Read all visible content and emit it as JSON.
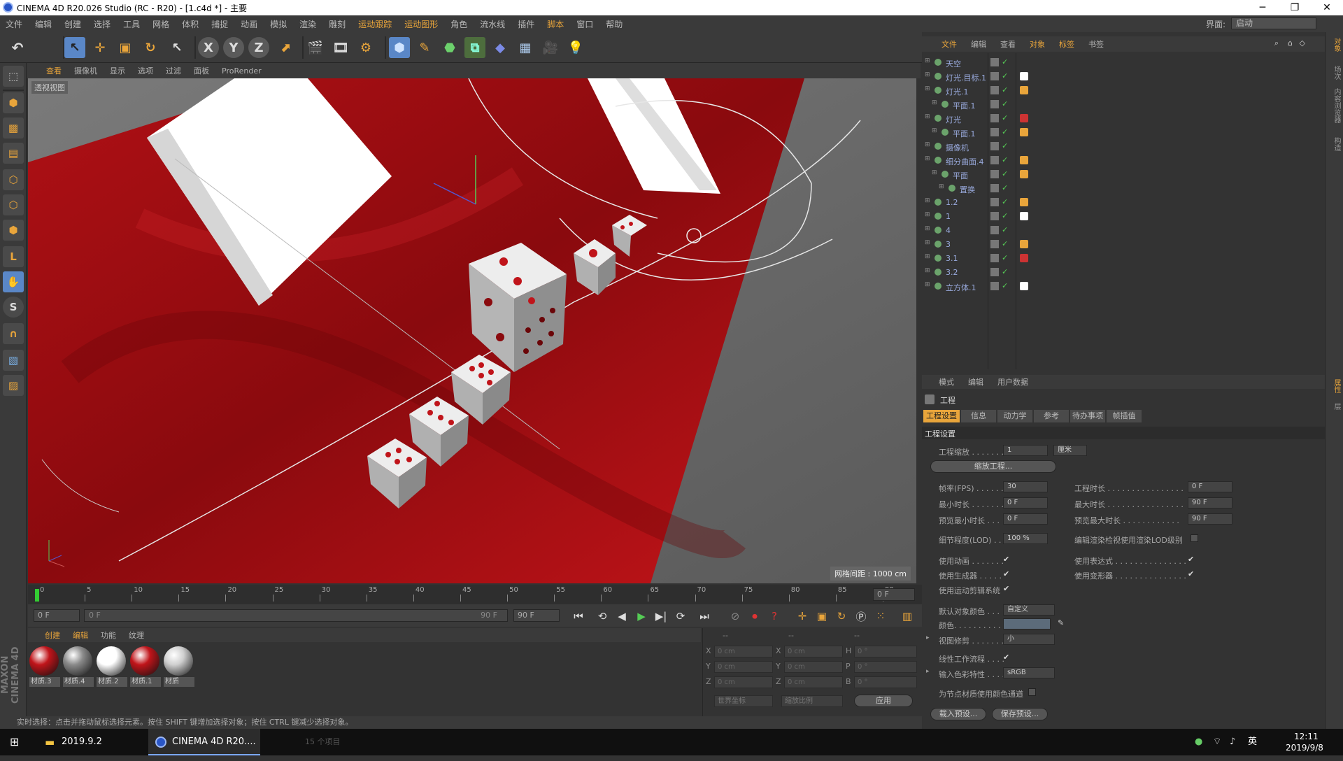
{
  "window": {
    "title": "CINEMA 4D R20.026 Studio (RC - R20) - [1.c4d *] - 主要",
    "minimize": "─",
    "maximize": "❐",
    "close": "✕"
  },
  "menubar": {
    "items": [
      "文件",
      "编辑",
      "创建",
      "选择",
      "工具",
      "网格",
      "体积",
      "捕捉",
      "动画",
      "模拟",
      "渲染",
      "雕刻",
      "运动跟踪",
      "运动图形",
      "角色",
      "流水线",
      "插件",
      "脚本",
      "窗口",
      "帮助"
    ],
    "layout_label": "界面:",
    "layout_value": "启动"
  },
  "viewport": {
    "menu": [
      "查看",
      "摄像机",
      "显示",
      "选项",
      "过滤",
      "面板",
      "ProRender"
    ],
    "label": "透视视图",
    "grid_distance": "网格间距 : 1000 cm"
  },
  "timeline": {
    "ticks": [
      "0",
      "5",
      "10",
      "15",
      "20",
      "25",
      "30",
      "35",
      "40",
      "45",
      "50",
      "55",
      "60",
      "65",
      "70",
      "75",
      "80",
      "85",
      "90"
    ],
    "current": "0 F"
  },
  "playback": {
    "start": "0 F",
    "range_start": "0 F",
    "range_end": "90 F",
    "end": "90 F"
  },
  "materials": {
    "menu": [
      "创建",
      "编辑",
      "功能",
      "纹理"
    ],
    "items": [
      {
        "name": "材质.3",
        "color": "#c0141a"
      },
      {
        "name": "材质.4",
        "color": "#8a8a8a"
      },
      {
        "name": "材质.2",
        "color": "#ffffff"
      },
      {
        "name": "材质.1",
        "color": "#c0141a"
      },
      {
        "name": "材质",
        "color": "#cfcfcf"
      }
    ]
  },
  "coords": {
    "header": [
      "--",
      "--",
      "--"
    ],
    "rows": [
      {
        "a": "X",
        "av": "0 cm",
        "b": "X",
        "bv": "0 cm",
        "c": "H",
        "cv": "0 °"
      },
      {
        "a": "Y",
        "av": "0 cm",
        "b": "Y",
        "bv": "0 cm",
        "c": "P",
        "cv": "0 °"
      },
      {
        "a": "Z",
        "av": "0 cm",
        "b": "Z",
        "bv": "0 cm",
        "c": "B",
        "cv": "0 °"
      }
    ],
    "world": "世界坐标",
    "scale": "缩放比例",
    "apply": "应用"
  },
  "status": "实时选择：点击并拖动鼠标选择元素。按住 SHIFT 键增加选择对象；按住 CTRL 键减少选择对象。",
  "object_manager": {
    "tabs": [
      "文件",
      "编辑",
      "查看",
      "对象",
      "标签",
      "书签"
    ],
    "objects": [
      {
        "name": "天空",
        "depth": 0
      },
      {
        "name": "灯光.目标.1",
        "depth": 0
      },
      {
        "name": "灯光.1",
        "depth": 0
      },
      {
        "name": "平面.1",
        "depth": 1
      },
      {
        "name": "灯光",
        "depth": 0
      },
      {
        "name": "平面.1",
        "depth": 1
      },
      {
        "name": "摄像机",
        "depth": 0
      },
      {
        "name": "细分曲面.4",
        "depth": 0
      },
      {
        "name": "平面",
        "depth": 1
      },
      {
        "name": "置换",
        "depth": 2
      },
      {
        "name": "1.2",
        "depth": 0
      },
      {
        "name": "1",
        "depth": 0
      },
      {
        "name": "4",
        "depth": 0
      },
      {
        "name": "3",
        "depth": 0
      },
      {
        "name": "3.1",
        "depth": 0
      },
      {
        "name": "3.2",
        "depth": 0
      },
      {
        "name": "立方体.1",
        "depth": 0
      }
    ]
  },
  "attribute_manager": {
    "top": [
      "模式",
      "编辑",
      "用户数据"
    ],
    "title": "工程",
    "tabs": [
      "工程设置",
      "信息",
      "动力学",
      "参考",
      "待办事项",
      "帧插值"
    ],
    "section": "工程设置",
    "scale_label": "工程缩放 . . . . . . .",
    "scale_value": "1",
    "scale_unit": "厘米",
    "scale_button": "缩放工程...",
    "fps_label": "帧率(FPS) . . . . . .",
    "fps": "30",
    "min_label": "最小时长 . . . . . . .",
    "min": "0 F",
    "pmin_label": "预览最小时长 . . .",
    "pmin": "0 F",
    "dur_label": "工程时长 . . . . . . . . . . . . . . . .",
    "dur": "0 F",
    "max_label": "最大时长 . . . . . . . . . . . . . . . .",
    "max": "90 F",
    "pmax_label": "预览最大时长 . . . . . . . . . . . .",
    "pmax": "90 F",
    "lod_label": "细节程度(LOD) . .",
    "lod": "100 %",
    "lodr_label": "编辑渲染检视使用渲染LOD级别",
    "anim_label": "使用动画 . . . . . . .",
    "gen_label": "使用生成器 . . . . .",
    "mt_label": "使用运动剪辑系统",
    "expr_label": "使用表达式 . . . . . . . . . . . . . . .",
    "def_label": "使用变形器 . . . . . . . . . . . . . . .",
    "objcol_label": "默认对象颜色 . . .",
    "objcol": "自定义",
    "color_label": "颜色. . . . . . . . . . . .",
    "vc_label": "视图修剪 . . . . . . .",
    "vc": "小",
    "linear_label": "线性工作流程 . . . .",
    "incol_label": "输入色彩特性 . . . .",
    "incol": "sRGB",
    "nodecol_label": "为节点材质使用颜色通道",
    "load": "载入预设...",
    "save": "保存预设..."
  },
  "right_strip": [
    "对象",
    "场次",
    "内容浏览器",
    "构造",
    "属性",
    "层"
  ],
  "taskbar": {
    "folder": "2019.9.2",
    "app": "CINEMA 4D R20....",
    "items_count": "15 个项目",
    "ime": "英",
    "time": "12:11",
    "date": "2019/9/8"
  }
}
